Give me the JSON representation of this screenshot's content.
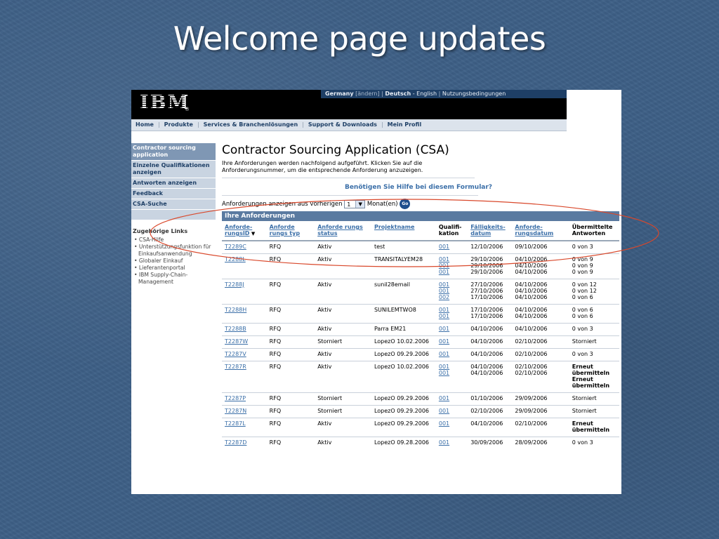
{
  "slide": {
    "title": "Welcome page updates"
  },
  "masthead": {
    "logo": "IBM",
    "country": "Germany",
    "change": "[ändern]",
    "lang_active": "Deutsch",
    "lang_other": "English",
    "terms": "Nutzungsbedingungen"
  },
  "nav": {
    "items": [
      "Home",
      "Produkte",
      "Services & Branchenlösungen",
      "Support & Downloads",
      "Mein Profil"
    ]
  },
  "sidebar": {
    "items": [
      {
        "label": "Contractor sourcing application",
        "active": true
      },
      {
        "label": "Einzelne Qualifikationen anzeigen",
        "active": false
      },
      {
        "label": "Antworten anzeigen",
        "active": false
      },
      {
        "label": "Feedback",
        "active": false
      },
      {
        "label": "CSA-Suche",
        "active": false
      }
    ],
    "related_title": "Zugehörige Links",
    "related": [
      "• CSA-Hilfe",
      "• Unterstützungsfunktion für Einkaufsanwendung",
      "• Globaler Einkauf",
      "• Lieferantenportal",
      "• IBM Supply-Chain-Management"
    ]
  },
  "main": {
    "title": "Contractor Sourcing Application (CSA)",
    "intro": "Ihre Anforderungen werden nachfolgend aufgeführt. Klicken Sie auf die Anforderungsnummer, um die entsprechende Anforderung anzuzeigen.",
    "help": "Benötigen Sie Hilfe bei diesem Formular?",
    "filter_prefix": "Anforderungen anzeigen aus vorherigen",
    "filter_value": "1",
    "filter_suffix": "Monat(en)",
    "go": "Go",
    "table_title": "Ihre Anforderungen"
  },
  "table": {
    "headers": [
      "Anforde-rungsID",
      "Anforde rungs typ",
      "Anforde rungs status",
      "Projektname",
      "Qualifi-kation",
      "Fälligkeits-datum",
      "Anforde-rungsdatum",
      "Übermittelte Antworten"
    ],
    "rows": [
      {
        "id": "T2289C",
        "type": "RFQ",
        "status": "Aktiv",
        "project": "test",
        "qual": [
          "001"
        ],
        "due": [
          "12/10/2006"
        ],
        "req": [
          "09/10/2006"
        ],
        "resp": [
          "0 von 3"
        ],
        "resp_bold": false
      },
      {
        "id": "T2288L",
        "type": "RFQ",
        "status": "Aktiv",
        "project": "TRANSITALYEM28",
        "qual": [
          "001",
          "001",
          "001"
        ],
        "due": [
          "29/10/2006",
          "29/10/2006",
          "29/10/2006"
        ],
        "req": [
          "04/10/2006",
          "04/10/2006",
          "04/10/2006"
        ],
        "resp": [
          "0 von 9",
          "0 von 9",
          "0 von 9"
        ],
        "resp_bold": false
      },
      {
        "id": "T2288J",
        "type": "RFQ",
        "status": "Aktiv",
        "project": "sunil28email",
        "qual": [
          "001",
          "001",
          "002"
        ],
        "due": [
          "27/10/2006",
          "27/10/2006",
          "17/10/2006"
        ],
        "req": [
          "04/10/2006",
          "04/10/2006",
          "04/10/2006"
        ],
        "resp": [
          "0 von 12",
          "0 von 12",
          "0 von 6"
        ],
        "resp_bold": false
      },
      {
        "id": "T2288H",
        "type": "RFQ",
        "status": "Aktiv",
        "project": "SUNILEMTWO8",
        "qual": [
          "001",
          "001"
        ],
        "due": [
          "17/10/2006",
          "17/10/2006"
        ],
        "req": [
          "04/10/2006",
          "04/10/2006"
        ],
        "resp": [
          "0 von 6",
          "0 von 6"
        ],
        "resp_bold": false
      },
      {
        "id": "T2288B",
        "type": "RFQ",
        "status": "Aktiv",
        "project": "Parra EM21",
        "qual": [
          "001"
        ],
        "due": [
          "04/10/2006"
        ],
        "req": [
          "04/10/2006"
        ],
        "resp": [
          "0 von 3"
        ],
        "resp_bold": false
      },
      {
        "id": "T2287W",
        "type": "RFQ",
        "status": "Storniert",
        "project": "LopezO 10.02.2006",
        "qual": [
          "001"
        ],
        "due": [
          "04/10/2006"
        ],
        "req": [
          "02/10/2006"
        ],
        "resp": [
          "Storniert"
        ],
        "resp_bold": false
      },
      {
        "id": "T2287V",
        "type": "RFQ",
        "status": "Aktiv",
        "project": "LopezO 09.29.2006",
        "qual": [
          "001"
        ],
        "due": [
          "04/10/2006"
        ],
        "req": [
          "02/10/2006"
        ],
        "resp": [
          "0 von 3"
        ],
        "resp_bold": false
      },
      {
        "id": "T2287R",
        "type": "RFQ",
        "status": "Aktiv",
        "project": "LopezO 10.02.2006",
        "qual": [
          "001",
          "001"
        ],
        "due": [
          "04/10/2006",
          "04/10/2006"
        ],
        "req": [
          "02/10/2006",
          "02/10/2006"
        ],
        "resp": [
          "Erneut übermitteln",
          "Erneut übermitteln"
        ],
        "resp_bold": true
      },
      {
        "id": "T2287P",
        "type": "RFQ",
        "status": "Storniert",
        "project": "LopezO 09.29.2006",
        "qual": [
          "001"
        ],
        "due": [
          "01/10/2006"
        ],
        "req": [
          "29/09/2006"
        ],
        "resp": [
          "Storniert"
        ],
        "resp_bold": false
      },
      {
        "id": "T2287N",
        "type": "RFQ",
        "status": "Storniert",
        "project": "LopezO 09.29.2006",
        "qual": [
          "001"
        ],
        "due": [
          "02/10/2006"
        ],
        "req": [
          "29/09/2006"
        ],
        "resp": [
          "Storniert"
        ],
        "resp_bold": false
      },
      {
        "id": "T2287L",
        "type": "RFQ",
        "status": "Aktiv",
        "project": "LopezO 09.29.2006",
        "qual": [
          "001"
        ],
        "due": [
          "04/10/2006"
        ],
        "req": [
          "02/10/2006"
        ],
        "resp": [
          "Erneut übermitteln"
        ],
        "resp_bold": true
      },
      {
        "id": "T2287D",
        "type": "RFQ",
        "status": "Aktiv",
        "project": "LopezO 09.28.2006",
        "qual": [
          "001"
        ],
        "due": [
          "30/09/2006"
        ],
        "req": [
          "28/09/2006"
        ],
        "resp": [
          "0 von 3"
        ],
        "resp_bold": false
      }
    ]
  },
  "annotation": {
    "color": "#d9482b"
  }
}
